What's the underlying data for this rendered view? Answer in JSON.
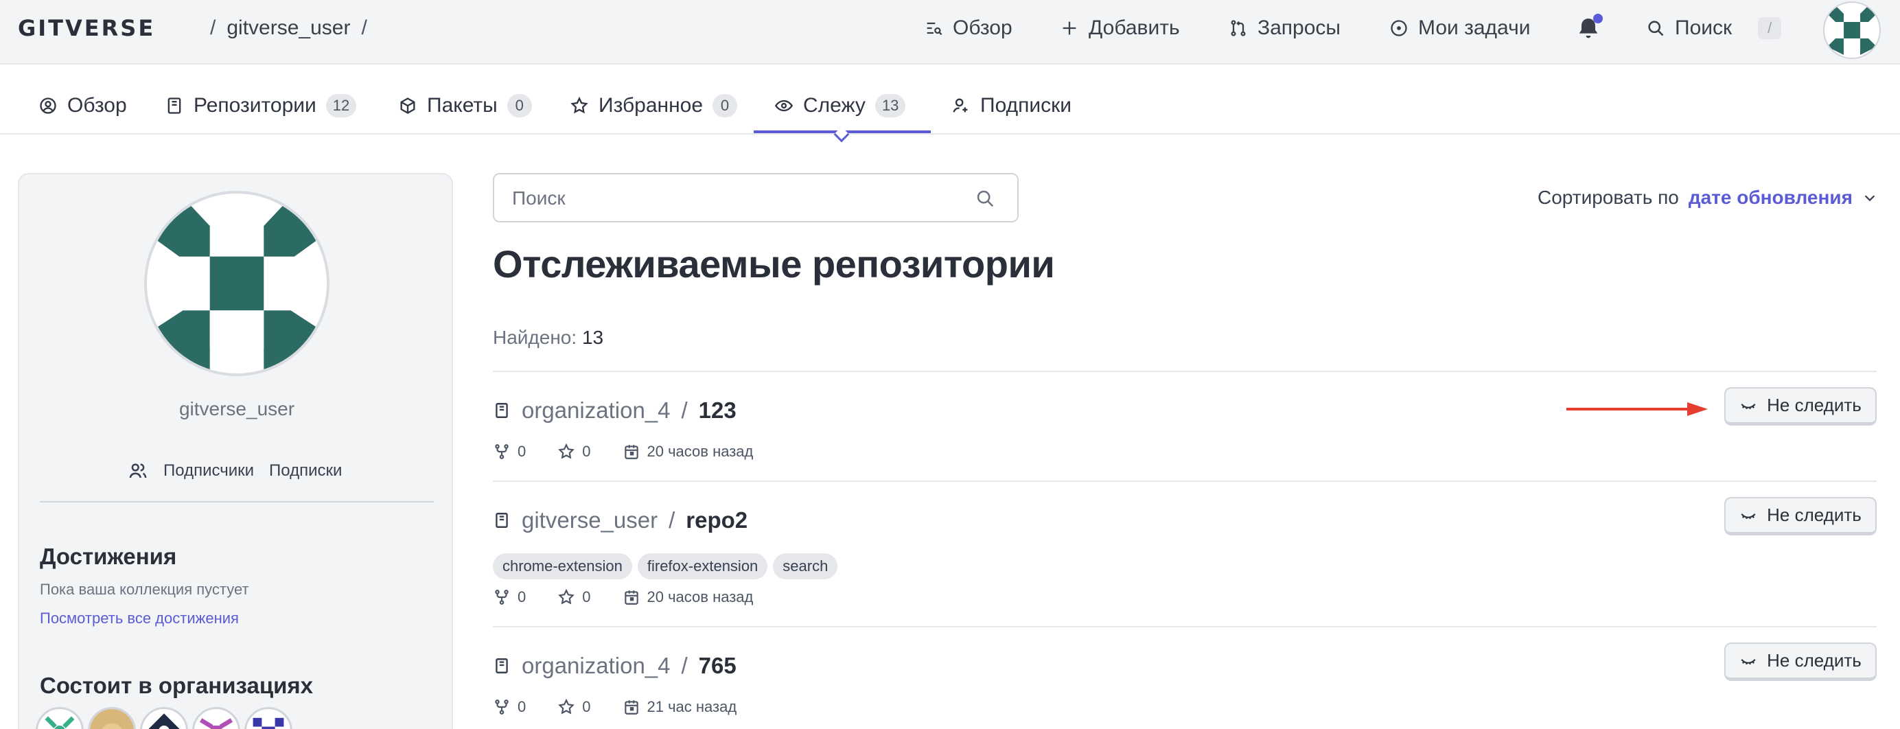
{
  "header": {
    "logo": "GITVERSE",
    "breadcrumb_user": "gitverse_user",
    "breadcrumb_sep": "/",
    "nav": {
      "overview": "Обзор",
      "add": "Добавить",
      "requests": "Запросы",
      "my_tasks": "Мои задачи",
      "search": "Поиск",
      "search_shortcut": "/"
    }
  },
  "tabs": [
    {
      "label": "Обзор",
      "icon": "user-circle-icon"
    },
    {
      "label": "Репозитории",
      "count": "12",
      "icon": "book-icon"
    },
    {
      "label": "Пакеты",
      "count": "0",
      "icon": "package-icon"
    },
    {
      "label": "Избранное",
      "count": "0",
      "icon": "star-icon"
    },
    {
      "label": "Слежу",
      "count": "13",
      "icon": "eye-icon",
      "active": true
    },
    {
      "label": "Подписки",
      "icon": "user-plus-icon"
    }
  ],
  "sidebar": {
    "username": "gitverse_user",
    "followers_label": "Подписчики",
    "following_label": "Подписки",
    "achievements_title": "Достижения",
    "achievements_empty": "Пока ваша коллекция пустует",
    "achievements_link": "Посмотреть все достижения",
    "orgs_title": "Состоит в организациях"
  },
  "main": {
    "search_placeholder": "Поиск",
    "sort_label": "Сортировать по",
    "sort_value": "дате обновления",
    "title": "Отслеживаемые репозитории",
    "found_label": "Найдено:",
    "found_count": "13",
    "unwatch_label": "Не следить",
    "repos": [
      {
        "owner": "organization_4",
        "name": "123",
        "forks": "0",
        "stars": "0",
        "updated": "20 часов назад",
        "tags": []
      },
      {
        "owner": "gitverse_user",
        "name": "repo2",
        "forks": "0",
        "stars": "0",
        "updated": "20 часов назад",
        "tags": [
          "chrome-extension",
          "firefox-extension",
          "search"
        ]
      },
      {
        "owner": "organization_4",
        "name": "765",
        "forks": "0",
        "stars": "0",
        "updated": "21 час назад",
        "tags": []
      }
    ]
  },
  "colors": {
    "accent": "#5b5bd6",
    "brand_green": "#2c6b63",
    "arrow_red": "#e53e2e"
  }
}
